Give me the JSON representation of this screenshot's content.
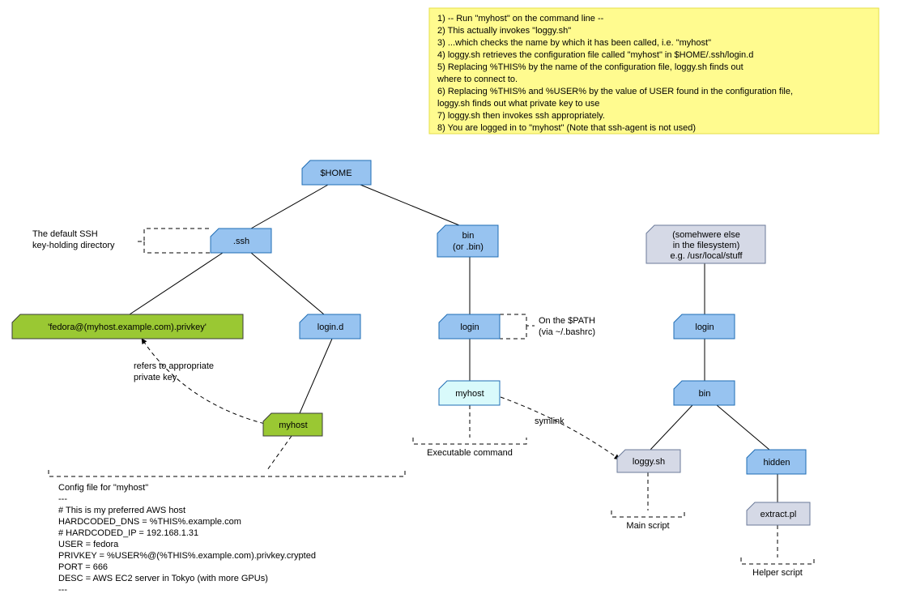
{
  "notebox": {
    "lines": [
      "1) -- Run \"myhost\" on the command line --",
      "2) This actually invokes \"loggy.sh\"",
      "3) ...which checks the name by which it has been called, i.e. \"myhost\"",
      "4) loggy.sh retrieves the configuration file called \"myhost\" in $HOME/.ssh/login.d",
      "5) Replacing %THIS% by the name of the configuration file, loggy.sh finds out",
      "    where to connect to.",
      "6) Replacing %THIS% and %USER% by the value of USER found in the configuration file,",
      "    loggy.sh finds out what private key to use",
      "7) loggy.sh then invokes ssh appropriately.",
      "8) You are logged in to \"myhost\" (Note that ssh-agent is not used)"
    ]
  },
  "nodes": {
    "home": "$HOME",
    "ssh": ".ssh",
    "bin_line1": "bin",
    "bin_line2": "(or .bin)",
    "elsewhere_line1": "(somehwere else",
    "elsewhere_line2": "in the filesystem)",
    "elsewhere_line3": "e.g. /usr/local/stuff",
    "privkey": "'fedora@(myhost.example.com).privkey'",
    "logind": "login.d",
    "login1": "login",
    "login2": "login",
    "myhost_cmd": "myhost",
    "myhost_cfg": "myhost",
    "bin2": "bin",
    "loggy": "loggy.sh",
    "hidden": "hidden",
    "extract": "extract.pl"
  },
  "labels": {
    "ssh_default_1": "The default SSH",
    "ssh_default_2": "key-holding directory",
    "on_path_1": "On the $PATH",
    "on_path_2": "(via ~/.bashrc)",
    "refers_1": "refers to appropriate",
    "refers_2": "private key",
    "symlink": "symlink",
    "exec_cmd": "Executable command",
    "main_script": "Main script",
    "helper_script": "Helper script"
  },
  "config": {
    "title": "Config file for \"myhost\"",
    "lines": [
      "---",
      "# This is my preferred AWS host",
      "HARDCODED_DNS  = %THIS%.example.com",
      "# HARDCODED_IP  = 192.168.1.31",
      "USER           = fedora",
      "PRIVKEY        = %USER%@(%THIS%.example.com).privkey.crypted",
      "PORT           = 666",
      "DESC           = AWS EC2 server in Tokyo (with more GPUs)",
      "---"
    ]
  },
  "colors": {
    "blue_fill": "#97c3f0",
    "blue_stroke": "#1f6db5",
    "cyan_fill": "#d9fafb",
    "cyan_stroke": "#1f6db5",
    "green_fill": "#9ac833",
    "green_stroke": "#3b3b3b",
    "grey_fill": "#d5d9e6",
    "grey_stroke": "#6b7a99",
    "note_bg": "#fffb8f",
    "note_stroke": "#e4df4a"
  }
}
